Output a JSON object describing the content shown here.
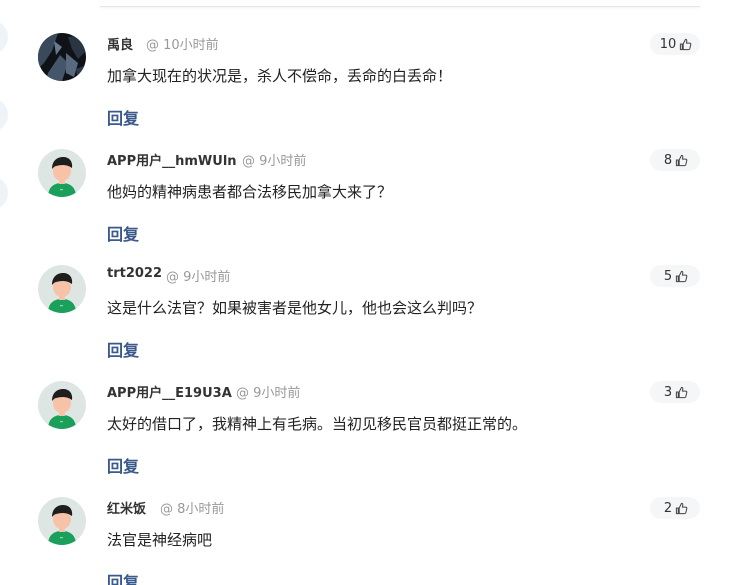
{
  "comments": [
    {
      "username": "禹良",
      "time": "@ 10小时前",
      "likes": "10",
      "text": "加拿大现在的状况是，杀人不偿命，丢命的白丢命！",
      "reply_label": "回复",
      "avatar_type": "photo"
    },
    {
      "username": "APP用户__hmWUln",
      "time": "@ 9小时前",
      "likes": "8",
      "text": "他妈的精神病患者都合法移民加拿大来了？",
      "reply_label": "回复",
      "avatar_type": "default"
    },
    {
      "username": "trt2022",
      "time": "@ 9小时前",
      "likes": "5",
      "text": "这是什么法官？如果被害者是他女儿，他也会这么判吗？",
      "reply_label": "回复",
      "avatar_type": "default"
    },
    {
      "username": "APP用户__E19U3A",
      "time": "@ 9小时前",
      "likes": "3",
      "text": "太好的借口了，我精神上有毛病。当初见移民官员都挺正常的。",
      "reply_label": "回复",
      "avatar_type": "default"
    },
    {
      "username": "红米饭",
      "time": "@ 8小时前",
      "likes": "2",
      "text": "法官是神经病吧",
      "reply_label": "回复",
      "avatar_type": "default"
    }
  ],
  "colors": {
    "reply": "#3a5a8c",
    "avatar_bg": "#dde6e3",
    "avatar_hair": "#1e1e1e",
    "avatar_skin": "#f7c2a8",
    "avatar_shirt": "#1aa05a"
  },
  "icons": {
    "like": "thumbs-up-icon"
  }
}
